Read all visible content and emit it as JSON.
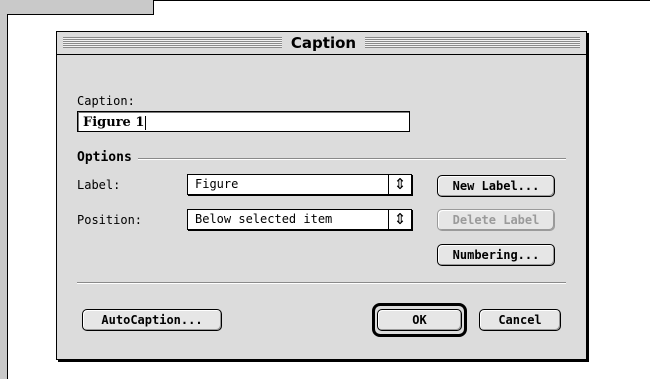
{
  "dialog": {
    "title": "Caption",
    "caption_label": "Caption:",
    "caption_value": "Figure 1",
    "options_title": "Options",
    "label_label": "Label:",
    "label_value": "Figure",
    "position_label": "Position:",
    "position_value": "Below selected item",
    "popup_arrows_icon": "up-down-arrows-icon"
  },
  "buttons": {
    "new_label": "New Label...",
    "delete_label": "Delete Label",
    "numbering": "Numbering...",
    "autocaption": "AutoCaption...",
    "ok": "OK",
    "cancel": "Cancel"
  }
}
